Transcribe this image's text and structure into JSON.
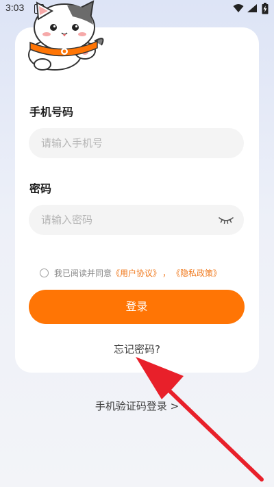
{
  "status_bar": {
    "time": "3:03",
    "notification_badge": "A",
    "icons": [
      "wifi-icon",
      "signal-icon",
      "battery-charging-icon"
    ]
  },
  "login_form": {
    "phone_label": "手机号码",
    "phone_placeholder": "请输入手机号",
    "phone_value": "",
    "password_label": "密码",
    "password_placeholder": "请输入密码",
    "password_value": "",
    "password_toggle_icon": "eye-closed-icon",
    "agreement": {
      "checked": false,
      "prefix": "我已阅读并同意",
      "user_agreement": "《用户协议》",
      "separator": "，",
      "privacy_policy": "《隐私政策》"
    },
    "login_button": "登录",
    "forgot_password": "忘记密码?"
  },
  "sms_login": "手机验证码登录 >",
  "colors": {
    "accent": "#ff7505",
    "link": "#f07a1e",
    "annotation_arrow": "#e8202a"
  }
}
